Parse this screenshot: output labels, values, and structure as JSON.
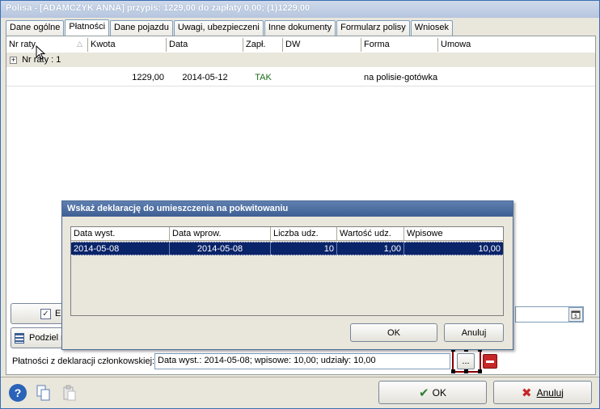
{
  "window": {
    "title": "Polisa - [ADAMCZYK ANNA]  przypis: 1229,00 do zapłaty 0,00; (1)1229,00"
  },
  "tabs": [
    {
      "label": "Dane ogólne",
      "active": false
    },
    {
      "label": "Płatności",
      "active": true
    },
    {
      "label": "Dane pojazdu",
      "active": false
    },
    {
      "label": "Uwagi, ubezpieczeni",
      "active": false
    },
    {
      "label": "Inne dokumenty",
      "active": false
    },
    {
      "label": "Formularz polisy",
      "active": false
    },
    {
      "label": "Wniosek",
      "active": false
    }
  ],
  "payments_grid": {
    "columns": [
      "Nr raty",
      "Kwota",
      "Data",
      "Zapł.",
      "DW",
      "Forma",
      "Umowa"
    ],
    "group_label": "Nr raty : 1",
    "rows": [
      {
        "kwota": "1229,00",
        "data": "2014-05-12",
        "zapl": "TAK",
        "dw": "",
        "forma": "na polisie-gotówka",
        "umowa": ""
      }
    ]
  },
  "left_buttons": {
    "first_label": "E",
    "second_label": "Podziel r"
  },
  "membership": {
    "label": "Płatności z deklaracji członkowskiej:",
    "value": "Data wyst.: 2014-05-08; wpisowe: 10,00; udziały: 10,00",
    "browse_label": "..."
  },
  "footer": {
    "ok_label": "OK",
    "cancel_label": "Anuluj"
  },
  "dialog": {
    "title": "Wskaż deklarację do umieszczenia na pokwitowaniu",
    "columns": [
      "Data wyst.",
      "Data wprow.",
      "Liczba udz.",
      "Wartość udz.",
      "Wpisowe"
    ],
    "rows": [
      {
        "data_wyst": "2014-05-08",
        "data_wprow": "2014-05-08",
        "liczba_udz": "10",
        "wartosc_udz": "1,00",
        "wpisowe": "10,00"
      }
    ],
    "ok_label": "OK",
    "cancel_label": "Anuluj"
  },
  "colors": {
    "selection": "#0a246a",
    "dialog_title": "#4a6ba0",
    "accept_green": "#2e7d32",
    "cancel_red": "#c62828"
  }
}
